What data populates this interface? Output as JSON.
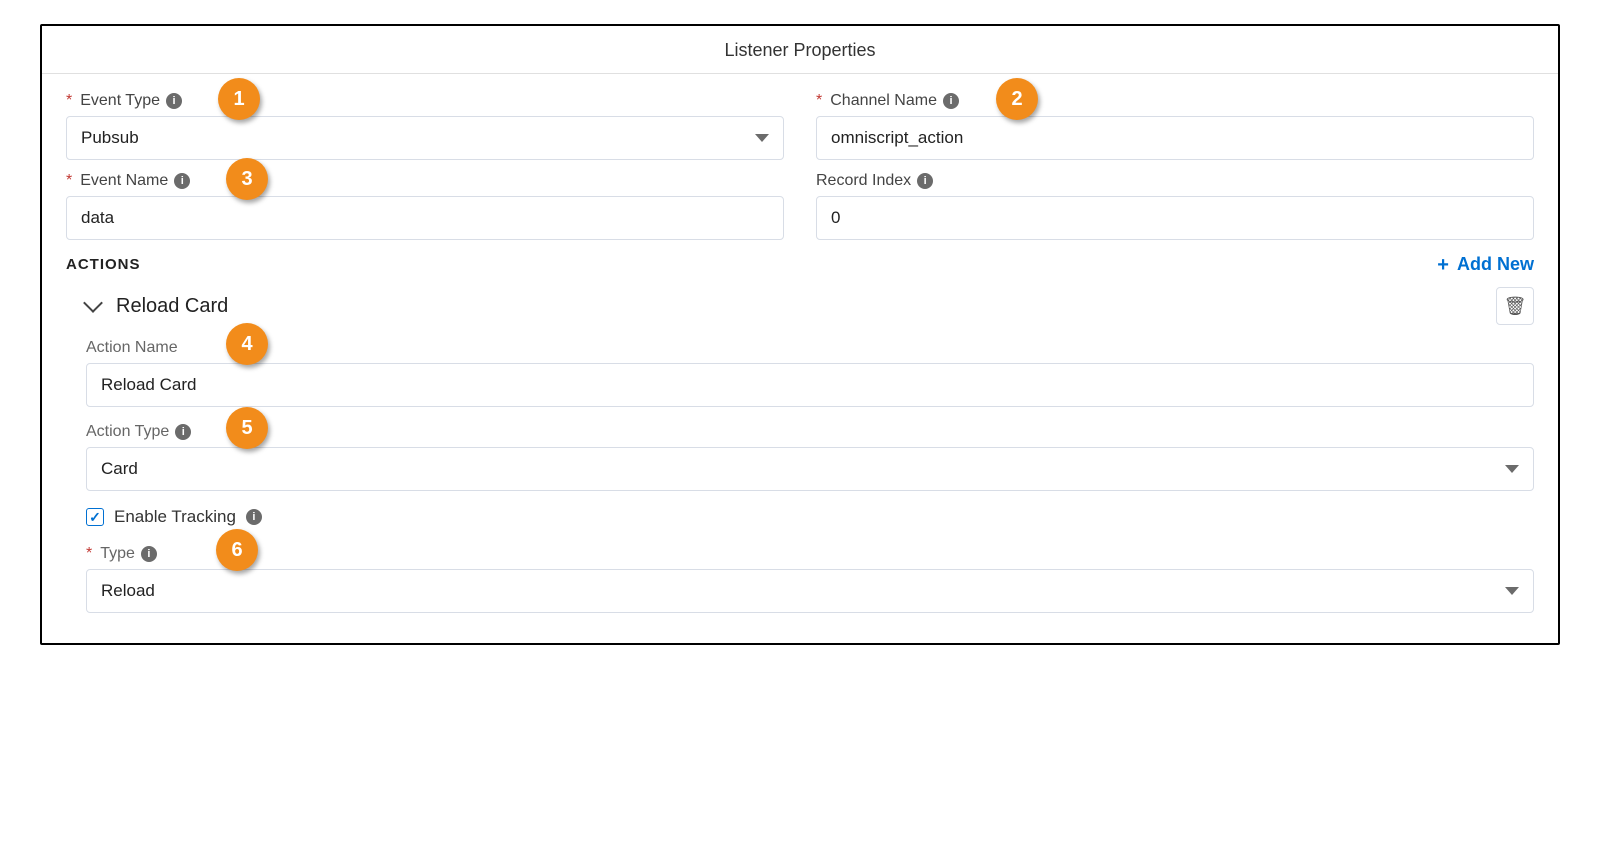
{
  "panel": {
    "title": "Listener Properties"
  },
  "fields": {
    "eventType": {
      "label": "Event Type",
      "value": "Pubsub",
      "required": true,
      "info": true,
      "kind": "select"
    },
    "channelName": {
      "label": "Channel Name",
      "value": "omniscript_action",
      "required": true,
      "info": true,
      "kind": "input"
    },
    "eventName": {
      "label": "Event Name",
      "value": "data",
      "required": true,
      "info": true,
      "kind": "input"
    },
    "recordIndex": {
      "label": "Record Index",
      "value": "0",
      "required": false,
      "info": true,
      "kind": "input"
    }
  },
  "actionsSection": {
    "title": "ACTIONS",
    "addNew": "Add New"
  },
  "action": {
    "title": "Reload Card",
    "actionName": {
      "label": "Action Name",
      "value": "Reload Card"
    },
    "actionType": {
      "label": "Action Type",
      "value": "Card",
      "info": true
    },
    "enableTracking": {
      "label": "Enable Tracking",
      "checked": true,
      "info": true
    },
    "type": {
      "label": "Type",
      "value": "Reload",
      "required": true,
      "info": true
    }
  },
  "callouts": {
    "c1": "1",
    "c2": "2",
    "c3": "3",
    "c4": "4",
    "c5": "5",
    "c6": "6"
  }
}
